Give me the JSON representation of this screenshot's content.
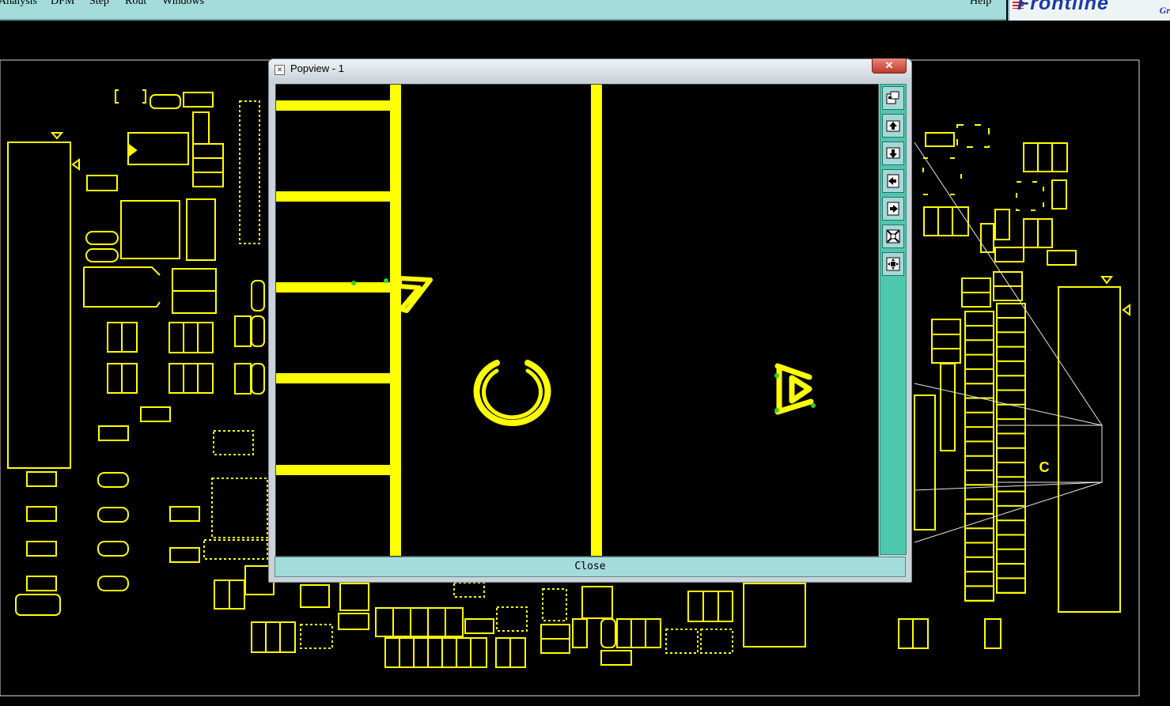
{
  "menubar": {
    "items": [
      {
        "label": "Analysis",
        "accel": ""
      },
      {
        "label": "DFM",
        "accel": ""
      },
      {
        "label": "Step",
        "accel": "S"
      },
      {
        "label": "Rout",
        "accel": "R"
      },
      {
        "label": "Windows",
        "accel": "W"
      }
    ],
    "help_label": "Help"
  },
  "logo": {
    "text": "Frontline",
    "secondary": "Gr"
  },
  "popview": {
    "title": "Popview - 1",
    "close_x": "✕",
    "close_button_label": "Close",
    "toolbar_buttons": [
      {
        "icon": "window-restore-icon"
      },
      {
        "icon": "layer-up-icon"
      },
      {
        "icon": "layer-down-icon"
      },
      {
        "icon": "pan-left-icon"
      },
      {
        "icon": "pan-right-icon"
      },
      {
        "icon": "zoom-fit-icon"
      },
      {
        "icon": "zoom-center-icon"
      }
    ],
    "canvas_glyph": "C"
  },
  "pcb": {
    "label_c": "C"
  },
  "colors": {
    "trace": "#ffff00",
    "background": "#000000",
    "toolbar": "#4ec8ac",
    "menubar": "#a4dcdc"
  }
}
